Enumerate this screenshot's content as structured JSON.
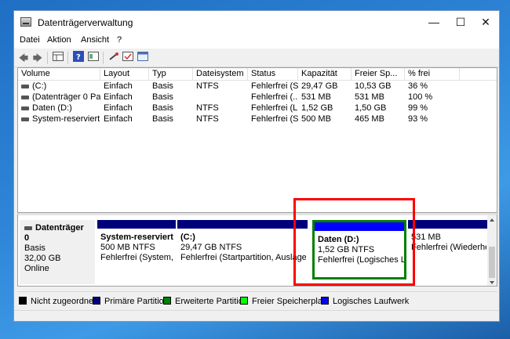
{
  "window": {
    "title": "Datenträgerverwaltung",
    "minimize_glyph": "—",
    "maximize_glyph": "☐",
    "close_glyph": "✕"
  },
  "menu": [
    "Datei",
    "Aktion",
    "Ansicht",
    "?"
  ],
  "toolbar": {
    "icons": [
      "back-icon",
      "forward-icon",
      "grid-icon",
      "help-icon",
      "properties-icon",
      "key-icon",
      "check-icon",
      "console-icon"
    ]
  },
  "columns": [
    "Volume",
    "Layout",
    "Typ",
    "Dateisystem",
    "Status",
    "Kapazität",
    "Freier Sp...",
    "% frei"
  ],
  "volumes": [
    {
      "volume": "(C:)",
      "layout": "Einfach",
      "typ": "Basis",
      "fs": "NTFS",
      "status": "Fehlerfrei (S...",
      "kap": "29,47 GB",
      "frei": "10,53 GB",
      "pct": "36 %"
    },
    {
      "volume": "(Datenträger 0 Par...",
      "layout": "Einfach",
      "typ": "Basis",
      "fs": "",
      "status": "Fehlerfrei (...",
      "kap": "531 MB",
      "frei": "531 MB",
      "pct": "100 %"
    },
    {
      "volume": "Daten (D:)",
      "layout": "Einfach",
      "typ": "Basis",
      "fs": "NTFS",
      "status": "Fehlerfrei (L...",
      "kap": "1,52 GB",
      "frei": "1,50 GB",
      "pct": "99 %"
    },
    {
      "volume": "System-reserviert",
      "layout": "Einfach",
      "typ": "Basis",
      "fs": "NTFS",
      "status": "Fehlerfrei (S...",
      "kap": "500 MB",
      "frei": "465 MB",
      "pct": "93 %"
    }
  ],
  "disk": {
    "name": "Datenträger 0",
    "type": "Basis",
    "size": "32,00 GB",
    "state": "Online",
    "partitions": [
      {
        "name": "System-reserviert",
        "size": "500 MB NTFS",
        "status": "Fehlerfrei (System, A"
      },
      {
        "name": "(C:)",
        "size": "29,47 GB NTFS",
        "status": "Fehlerfrei (Startpartition, Auslagerun"
      },
      {
        "name": "Daten  (D:)",
        "size": "1,52 GB NTFS",
        "status": "Fehlerfrei (Logisches La"
      },
      {
        "name": "",
        "size": "531 MB",
        "status": "Fehlerfrei (Wiederher:"
      }
    ]
  },
  "legend": [
    {
      "label": "Nicht zugeordnet",
      "color": "#000000"
    },
    {
      "label": "Primäre Partition",
      "color": "#00007b"
    },
    {
      "label": "Erweiterte Partition",
      "color": "#008000"
    },
    {
      "label": "Freier Speicherplatz",
      "color": "#00ff00"
    },
    {
      "label": "Logisches Laufwerk",
      "color": "#0000ff"
    }
  ],
  "colors": {
    "primary_bar": "#00007b",
    "logical_bar": "#0000ff",
    "extended_border": "#008000",
    "highlight": "#ff0000"
  }
}
